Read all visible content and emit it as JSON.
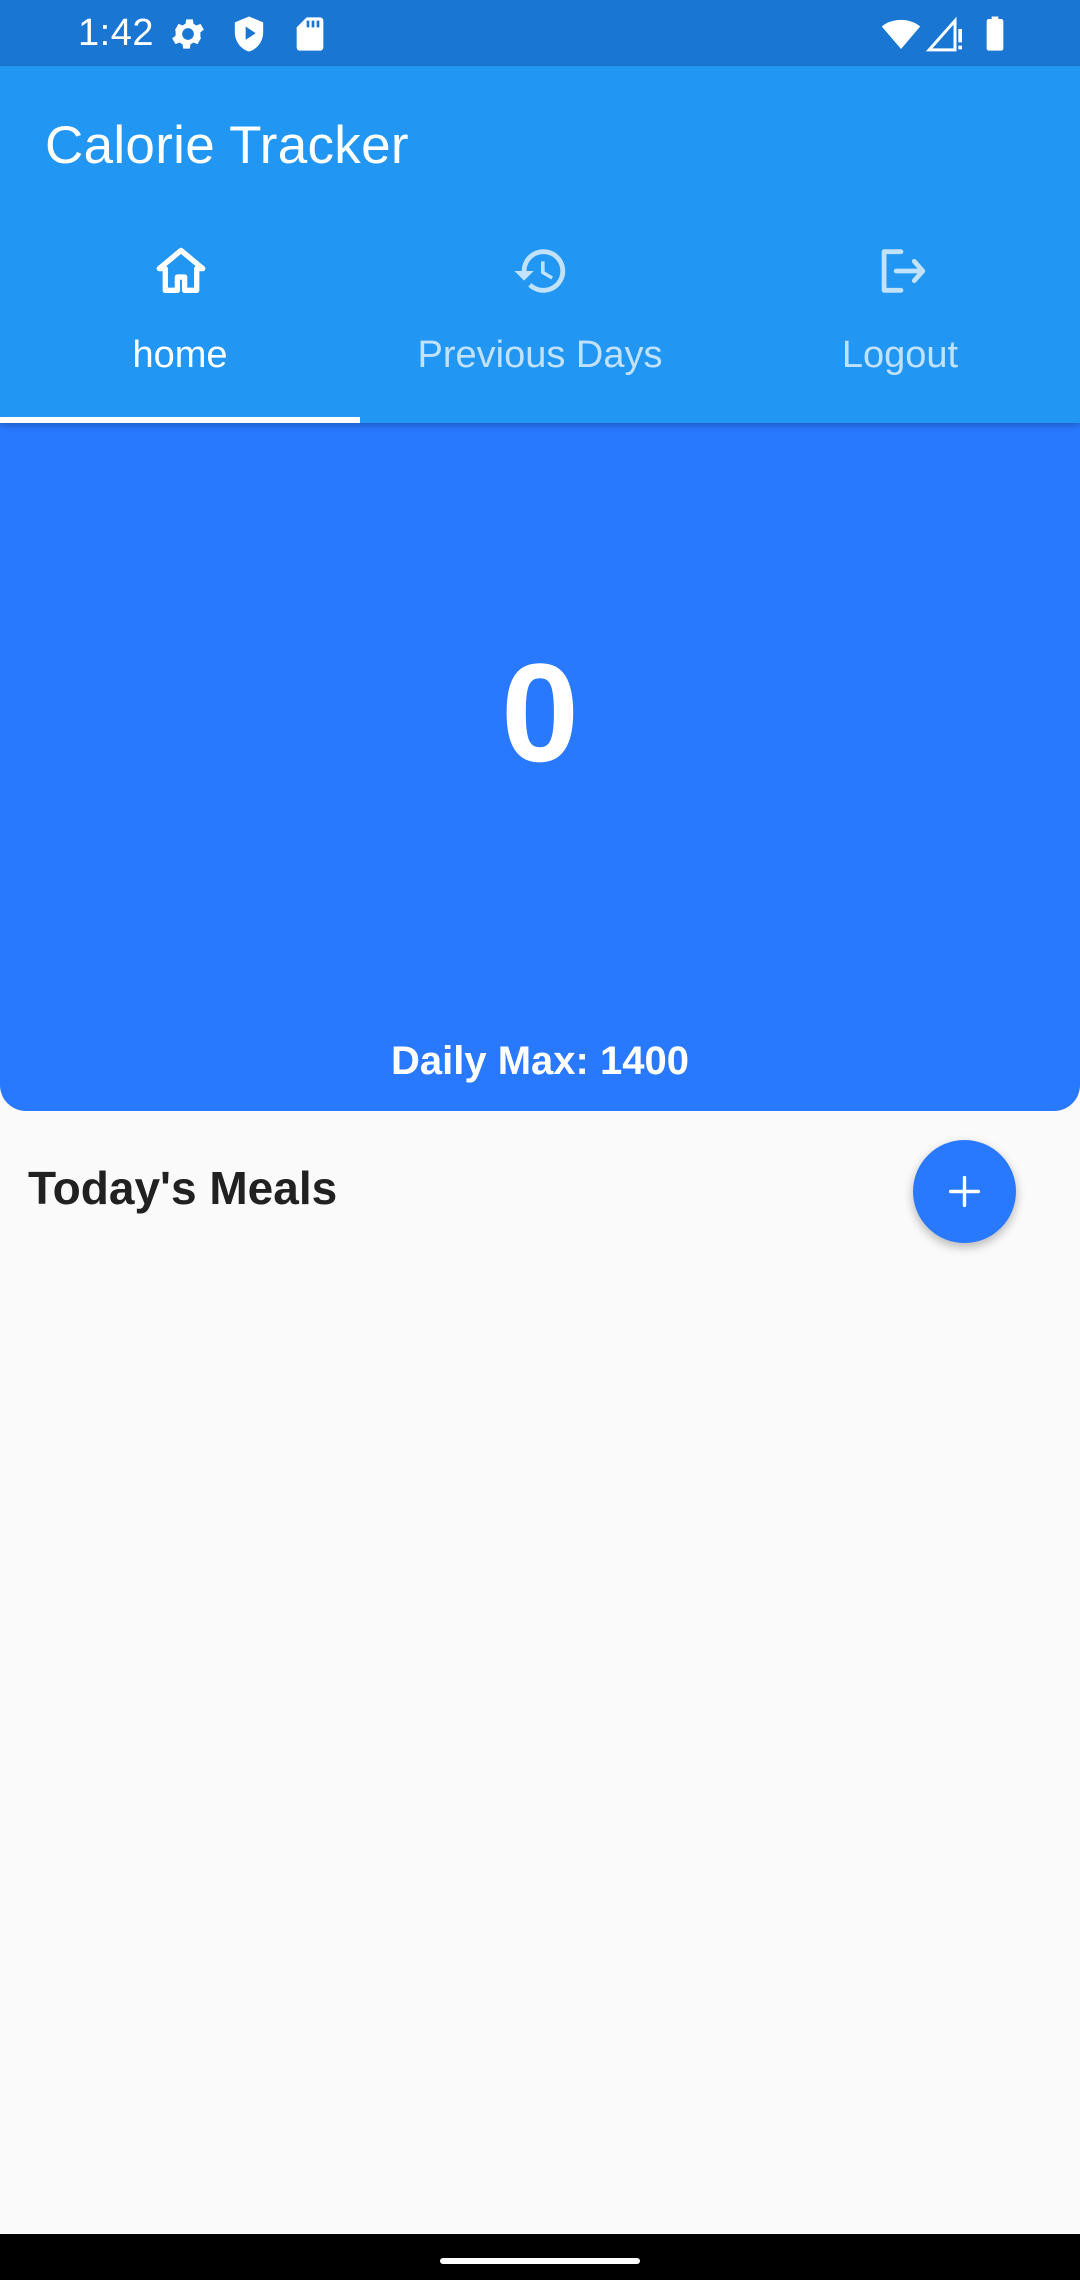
{
  "status_bar": {
    "time": "1:42",
    "left_icons": [
      "settings-icon",
      "shield-play-icon",
      "sd-card-icon"
    ],
    "right_icons": [
      "wifi-icon",
      "cellular-no-data-icon",
      "battery-icon"
    ]
  },
  "app_bar": {
    "title": "Calorie Tracker",
    "tabs": [
      {
        "label": "home",
        "icon": "home-icon",
        "selected": true
      },
      {
        "label": "Previous Days",
        "icon": "history-icon",
        "selected": false
      },
      {
        "label": "Logout",
        "icon": "logout-icon",
        "selected": false
      }
    ]
  },
  "calorie_card": {
    "count": "0",
    "daily_max": "Daily Max: 1400"
  },
  "meals": {
    "header": "Today's Meals",
    "add_icon": "plus-icon",
    "items": []
  },
  "colors": {
    "status_bar": "#1976D2",
    "app_bar": "#2196F3",
    "card": "#2979FF",
    "fab": "#2979FF",
    "background": "#FAFAFA",
    "header_text": "#212121"
  }
}
